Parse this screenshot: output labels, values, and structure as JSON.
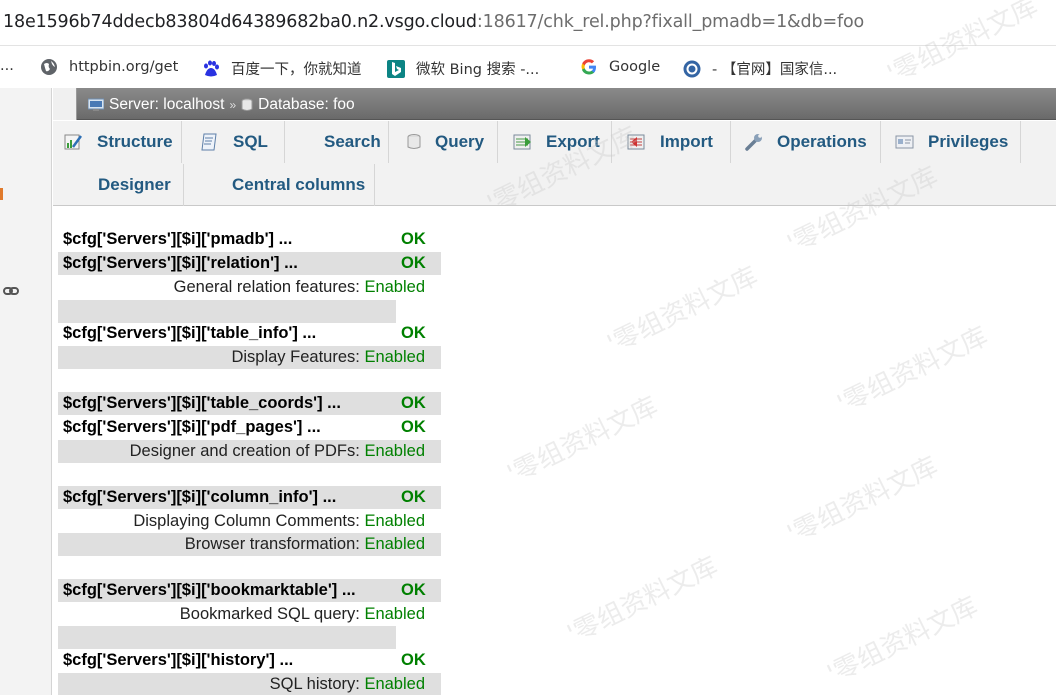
{
  "browser": {
    "url_host": "18e1596b74ddecb83804d64389682ba0.n2.vsgo.cloud",
    "url_rest": ":18617/chk_rel.php?fixall_pmadb=1&db=foo",
    "bookmarks": [
      {
        "label": "...",
        "icon": "folder-icon"
      },
      {
        "label": "httpbin.org/get",
        "icon": "globe-icon"
      },
      {
        "label": "百度一下，你就知道",
        "icon": "baidu-icon"
      },
      {
        "label": "微软 Bing 搜索 -...",
        "icon": "bing-icon"
      },
      {
        "label": "Google",
        "icon": "google-icon"
      },
      {
        "label": "- 【官网】国家信...",
        "icon": "gov-icon"
      }
    ]
  },
  "breadcrumb": {
    "server": "Server: localhost",
    "separator": "»",
    "database": "Database: foo"
  },
  "tabs_row1": [
    {
      "label": "Structure",
      "icon": "structure-icon"
    },
    {
      "label": "SQL",
      "icon": "sql-icon"
    },
    {
      "label": "Search",
      "icon": "search-icon"
    },
    {
      "label": "Query",
      "icon": "query-icon"
    },
    {
      "label": "Export",
      "icon": "export-icon"
    },
    {
      "label": "Import",
      "icon": "import-icon"
    },
    {
      "label": "Operations",
      "icon": "wrench-icon"
    },
    {
      "label": "Privileges",
      "icon": "privileges-icon"
    }
  ],
  "tabs_row2": [
    {
      "label": "Designer"
    },
    {
      "label": "Central columns"
    }
  ],
  "status": {
    "ok": "OK",
    "enabled": "Enabled",
    "rows": [
      {
        "key": "$cfg['Servers'][$i]['pmadb'] ..."
      },
      {
        "key": "$cfg['Servers'][$i]['relation'] ..."
      },
      {
        "desc": "General relation features:"
      },
      {
        "key": "$cfg['Servers'][$i]['table_info'] ..."
      },
      {
        "desc": "Display Features:"
      },
      {
        "key": "$cfg['Servers'][$i]['table_coords'] ..."
      },
      {
        "key": "$cfg['Servers'][$i]['pdf_pages'] ..."
      },
      {
        "desc": "Designer and creation of PDFs:"
      },
      {
        "key": "$cfg['Servers'][$i]['column_info'] ..."
      },
      {
        "desc": "Displaying Column Comments:"
      },
      {
        "desc": "Browser transformation:"
      },
      {
        "key": "$cfg['Servers'][$i]['bookmarktable'] ..."
      },
      {
        "desc": "Bookmarked SQL query:"
      },
      {
        "key": "$cfg['Servers'][$i]['history'] ..."
      },
      {
        "desc": "SQL history:"
      }
    ]
  },
  "watermark": "'零组资料文库"
}
